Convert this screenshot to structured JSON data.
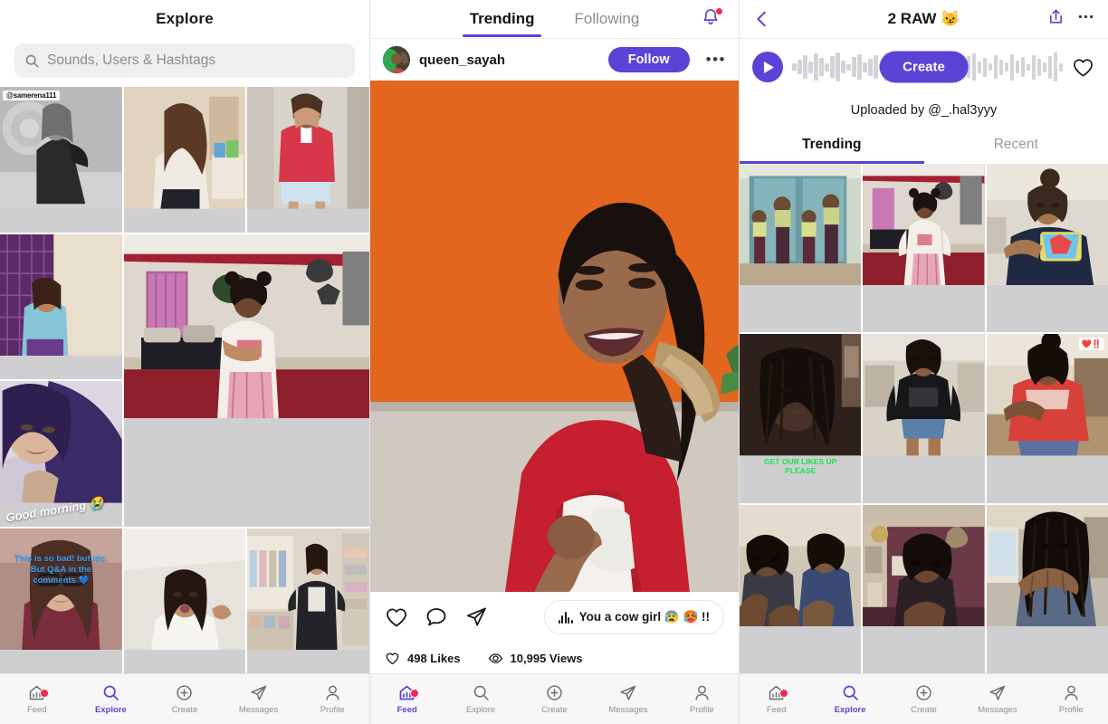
{
  "explore": {
    "title": "Explore",
    "search_placeholder": "Sounds, Users & Hashtags",
    "tiles": [
      {
        "id": "t1",
        "badge": "@samerena111",
        "overlay": "",
        "scene": "bw-bedroom"
      },
      {
        "id": "t2",
        "badge": "",
        "overlay": "",
        "scene": "tan-room-curls"
      },
      {
        "id": "t3",
        "badge": "",
        "overlay": "",
        "scene": "red-jacket-hall"
      },
      {
        "id": "t4",
        "badge": "",
        "overlay": "",
        "scene": "purple-curtain"
      },
      {
        "id": "t5",
        "badge": "",
        "overlay": "",
        "scene": "living-room-wide",
        "wide": true
      },
      {
        "id": "t6",
        "badge": "",
        "overlay": "Good morning 😭",
        "overlay_style": "script",
        "scene": "purple-hair-closeup"
      },
      {
        "id": "t7",
        "badge": "",
        "overlay": "This is so bad! but idc.\nBut Q&A in the\ncomments 💙",
        "overlay_style": "blue",
        "scene": "glasses-maroon"
      },
      {
        "id": "t8",
        "badge": "",
        "overlay": "",
        "scene": "white-wall-girl"
      },
      {
        "id": "t9",
        "badge": "",
        "overlay": "",
        "scene": "closet-store"
      }
    ]
  },
  "feed": {
    "tabs": [
      {
        "label": "Trending",
        "active": true
      },
      {
        "label": "Following",
        "active": false
      }
    ],
    "notifications_icon": "bell-icon",
    "has_notification": true,
    "post": {
      "username": "queen_sayah",
      "follow_label": "Follow",
      "more_label": "•••",
      "sound_label": "You a cow girl 😰 🥵 !!",
      "likes": "498 Likes",
      "views": "10,995 Views",
      "actions": [
        "heart-icon",
        "comment-icon",
        "share-icon"
      ]
    }
  },
  "sound": {
    "title": "2 RAW 😼",
    "back_icon": "chevron-left-icon",
    "share_icon": "share-up-icon",
    "more_icon": "more-icon",
    "create_label": "Create",
    "uploaded_by": "Uploaded by @_.hal3yyy",
    "tabs": [
      {
        "label": "Trending",
        "active": true
      },
      {
        "label": "Recent",
        "active": false
      }
    ],
    "tiles": [
      {
        "id": "s1",
        "overlay": "",
        "scene": "group-teal"
      },
      {
        "id": "s2",
        "overlay": "",
        "scene": "living-room-girl"
      },
      {
        "id": "s3",
        "overlay": "",
        "scene": "navy-hoodie"
      },
      {
        "id": "s4",
        "overlay": "GET OUR LIKES UP\nPLEASE",
        "overlay_style": "green",
        "scene": "dark-room-braids"
      },
      {
        "id": "s5",
        "overlay": "",
        "scene": "black-tee-shorts"
      },
      {
        "id": "s6",
        "overlay": "",
        "badge": "❤️‼️",
        "scene": "red-sweatshirt"
      },
      {
        "id": "s7",
        "overlay": "",
        "scene": "two-people-hands"
      },
      {
        "id": "s8",
        "overlay": "",
        "scene": "maroon-wall"
      },
      {
        "id": "s9",
        "overlay": "",
        "scene": "braids-hands-up"
      }
    ]
  },
  "tabbar": {
    "items": [
      {
        "label": "Feed",
        "icon": "home-feed-icon",
        "badge": true
      },
      {
        "label": "Explore",
        "icon": "search-icon",
        "badge": false
      },
      {
        "label": "Create",
        "icon": "plus-circle-icon",
        "badge": false
      },
      {
        "label": "Messages",
        "icon": "paper-plane-icon",
        "badge": false
      },
      {
        "label": "Profile",
        "icon": "person-icon",
        "badge": false
      }
    ],
    "active_left": "Explore",
    "active_middle": "Feed",
    "active_right": "Explore"
  },
  "colors": {
    "accent": "#5b43d6",
    "badge": "#f5274e",
    "video_bg": "#e8661e",
    "muted": "#8e8e94"
  }
}
